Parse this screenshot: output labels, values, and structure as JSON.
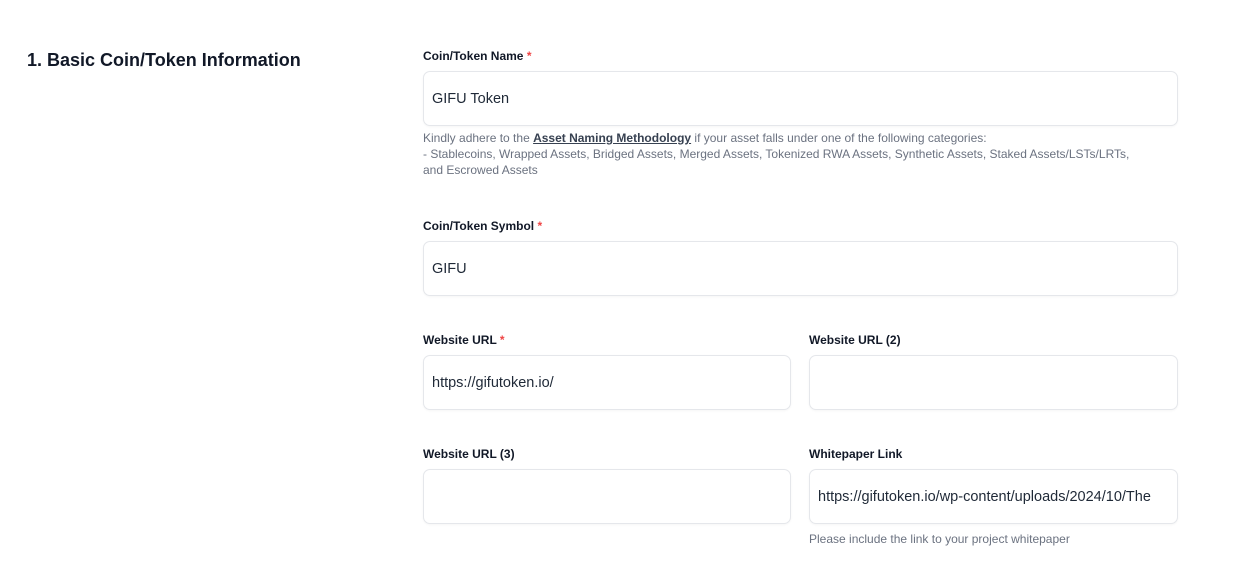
{
  "section": {
    "title": "1. Basic Coin/Token Information"
  },
  "fields": {
    "token_name": {
      "label": "Coin/Token Name",
      "required_mark": "*",
      "value": "GIFU Token"
    },
    "naming_help": {
      "prefix": "Kindly adhere to the ",
      "link_text": "Asset Naming Methodology",
      "suffix": " if your asset falls under one of the following categories:",
      "line2": "- Stablecoins, Wrapped Assets, Bridged Assets, Merged Assets, Tokenized RWA Assets, Synthetic Assets, Staked Assets/LSTs/LRTs,",
      "line3": "and Escrowed Assets"
    },
    "token_symbol": {
      "label": "Coin/Token Symbol",
      "required_mark": "*",
      "value": "GIFU"
    },
    "website_url": {
      "label": "Website URL",
      "required_mark": "*",
      "value": "https://gifutoken.io/"
    },
    "website_url_2": {
      "label": "Website URL (2)",
      "value": ""
    },
    "website_url_3": {
      "label": "Website URL (3)",
      "value": ""
    },
    "whitepaper": {
      "label": "Whitepaper Link",
      "value": "https://gifutoken.io/wp-content/uploads/2024/10/The",
      "help": "Please include the link to your project whitepaper"
    }
  },
  "colors": {
    "required": "#ef4444",
    "border": "#e5e7eb",
    "help_text": "#6b7280"
  }
}
